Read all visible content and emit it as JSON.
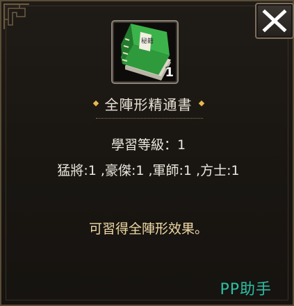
{
  "item": {
    "name": "全陣形精通書",
    "count": "1",
    "icon": "green-book-icon",
    "cover_text": "秘籍"
  },
  "details": {
    "study_level": "學習等級：1",
    "unit_types": "猛將:1 ,豪傑:1 ,軍師:1 ,方士:1",
    "effect": "可習得全陣形效果。"
  },
  "close": {
    "icon": "close-icon"
  },
  "watermark": {
    "text": "PP助手"
  },
  "colors": {
    "title": "#e9e3d6",
    "effect": "#f0d9a4",
    "diamond": "#e8b84a",
    "watermark": "#2cbfa4",
    "book": "#2f9a3c"
  }
}
